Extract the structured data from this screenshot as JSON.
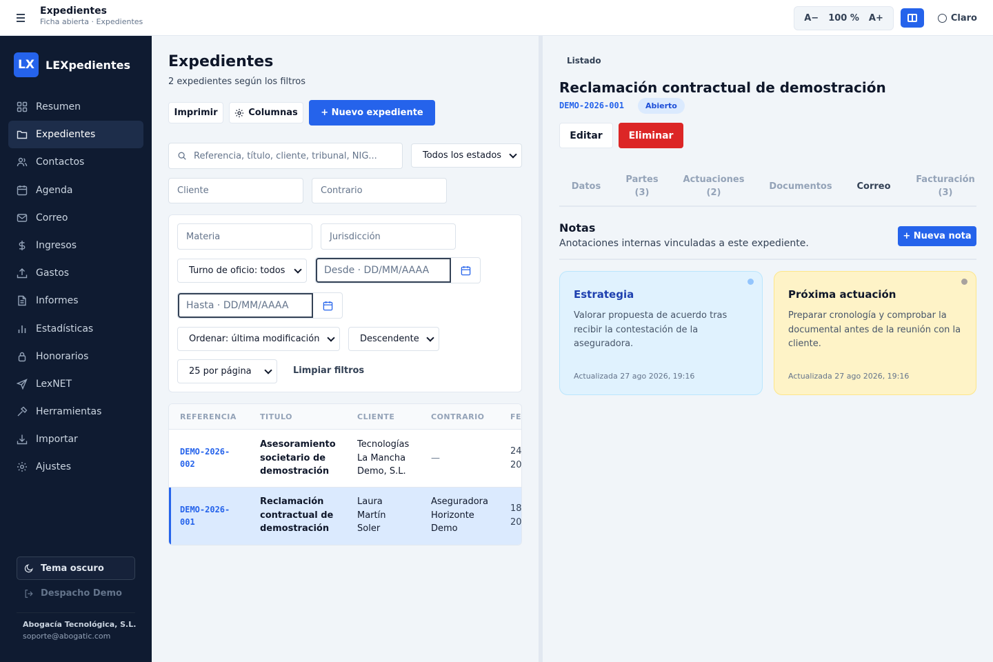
{
  "topbar": {
    "title": "Expedientes",
    "subtitle": "Ficha abierta · Expedientes",
    "zoom_out": "A−",
    "zoom_level": "100 %",
    "zoom_in": "A+",
    "theme_label": "Claro"
  },
  "sidebar": {
    "logo": "LX",
    "brand": "LEXpedientes",
    "items": [
      {
        "label": "Resumen",
        "icon": "grid-icon"
      },
      {
        "label": "Expedientes",
        "icon": "folder-icon",
        "active": true
      },
      {
        "label": "Contactos",
        "icon": "users-icon"
      },
      {
        "label": "Agenda",
        "icon": "calendar-icon"
      },
      {
        "label": "Correo",
        "icon": "mail-icon"
      },
      {
        "label": "Ingresos",
        "icon": "dollar-icon"
      },
      {
        "label": "Gastos",
        "icon": "upload-icon"
      },
      {
        "label": "Informes",
        "icon": "file-text-icon"
      },
      {
        "label": "Estadísticas",
        "icon": "bar-chart-icon"
      },
      {
        "label": "Honorarios",
        "icon": "lock-icon"
      },
      {
        "label": "LexNET",
        "icon": "send-icon"
      },
      {
        "label": "Herramientas",
        "icon": "hammer-icon"
      },
      {
        "label": "Importar",
        "icon": "download-icon"
      },
      {
        "label": "Ajustes",
        "icon": "gear-icon"
      }
    ],
    "dark_theme": "Tema oscuro",
    "logout": "Despacho Demo",
    "org": "Abogacía Tecnológica, S.L.",
    "email": "soporte@abogatic.com"
  },
  "list": {
    "title": "Expedientes",
    "subtitle": "2 expedientes según los filtros",
    "print": "Imprimir",
    "columns": "Columnas",
    "new": "+ Nuevo expediente",
    "search_placeholder": "Referencia, título, cliente, tribunal, NIG...",
    "status_select": "Todos los estados",
    "client_placeholder": "Cliente",
    "opponent_placeholder": "Contrario",
    "matter_placeholder": "Materia",
    "jurisdiction_placeholder": "Jurisdicción",
    "turno_select": "Turno de oficio: todos",
    "from_placeholder": "Desde · DD/MM/AAAA",
    "to_placeholder": "Hasta · DD/MM/AAAA",
    "order_select": "Ordenar: última modificación",
    "direction_select": "Descendente",
    "page_select": "25 por página",
    "clear": "Limpiar filtros",
    "columns_headers": [
      "REFERENCIA",
      "TITULO",
      "CLIENTE",
      "CONTRARIO",
      "FE"
    ],
    "rows": [
      {
        "ref": [
          "DEMO-2026-",
          "002"
        ],
        "title": [
          "Asesoramiento",
          "societario de",
          "demostración"
        ],
        "client": [
          "Tecnologías",
          "La Mancha",
          "Demo, S.L."
        ],
        "opponent": [
          "—"
        ],
        "date": [
          "24",
          "20"
        ]
      },
      {
        "ref": [
          "DEMO-2026-",
          "001"
        ],
        "title": [
          "Reclamación",
          "contractual de",
          "demostración"
        ],
        "client": [
          "Laura",
          "Martín",
          "Soler"
        ],
        "opponent": [
          "Aseguradora",
          "Horizonte",
          "Demo"
        ],
        "date": [
          "18",
          "20"
        ]
      }
    ]
  },
  "detail": {
    "back": "Listado",
    "title": "Reclamación contractual de demostración",
    "ref": "DEMO-2026-001",
    "status": "Abierto",
    "edit": "Editar",
    "delete": "Eliminar",
    "tabs": [
      {
        "label": "Datos",
        "count": ""
      },
      {
        "label": "Partes",
        "count": "(3)"
      },
      {
        "label": "Actuaciones",
        "count": "(2)"
      },
      {
        "label": "Documentos",
        "count": ""
      },
      {
        "label": "Correo",
        "count": "",
        "active": true
      },
      {
        "label": "Facturación",
        "count": "(3)"
      }
    ],
    "notes_title": "Notas",
    "notes_subtitle": "Anotaciones internas vinculadas a este expediente.",
    "new_note": "+ Nueva nota",
    "notes": [
      {
        "title": "Estrategia",
        "body": "Valorar propuesta de acuerdo tras recibir la contestación de la aseguradora.",
        "updated": "Actualizada 27 ago 2026, 19:16",
        "color": "#e0f2fe"
      },
      {
        "title": "Próxima actuación",
        "body": "Preparar cronología y comprobar la documental antes de la reunión con la cliente.",
        "updated": "Actualizada 27 ago 2026, 19:16",
        "color": "#fef3c7"
      }
    ]
  },
  "colors": {
    "accent": "#2563eb",
    "danger": "#dc2626",
    "sidebar": "#0f1b31"
  }
}
